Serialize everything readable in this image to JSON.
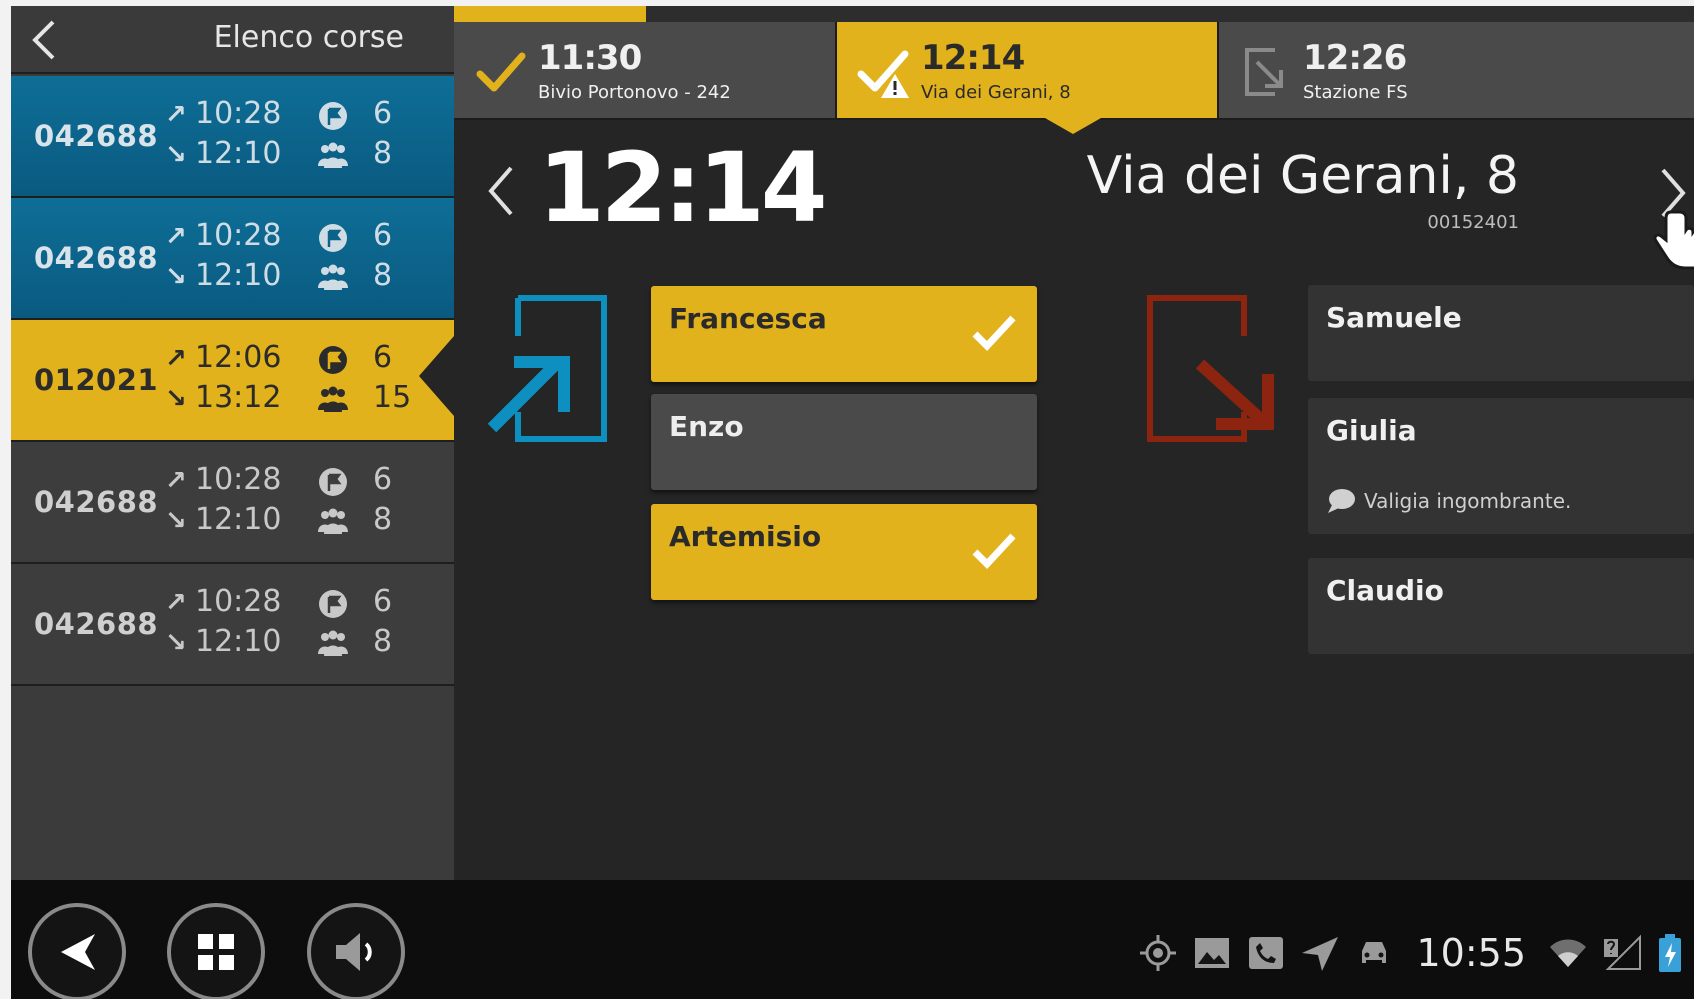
{
  "header": {
    "title": "Elenco corse"
  },
  "runs": [
    {
      "code": "042688",
      "dep": "10:28",
      "arr": "12:10",
      "stops": "6",
      "passengers": "8",
      "state": "blue"
    },
    {
      "code": "042688",
      "dep": "10:28",
      "arr": "12:10",
      "stops": "6",
      "passengers": "8",
      "state": "blue"
    },
    {
      "code": "012021",
      "dep": "12:06",
      "arr": "13:12",
      "stops": "6",
      "passengers": "15",
      "state": "selected"
    },
    {
      "code": "042688",
      "dep": "10:28",
      "arr": "12:10",
      "stops": "6",
      "passengers": "8",
      "state": "grey"
    },
    {
      "code": "042688",
      "dep": "10:28",
      "arr": "12:10",
      "stops": "6",
      "passengers": "8",
      "state": "grey"
    }
  ],
  "progress": {
    "fraction": 0.155
  },
  "tabs": [
    {
      "time": "11:30",
      "name": "Bivio Portonovo - 242",
      "state": "done"
    },
    {
      "time": "12:14",
      "name": "Via dei Gerani, 8",
      "state": "current"
    },
    {
      "time": "12:26",
      "name": "Stazione FS",
      "state": "next"
    }
  ],
  "stop": {
    "time": "12:14",
    "name": "Via dei Gerani, 8",
    "code": "00152401"
  },
  "boarding": [
    {
      "name": "Francesca",
      "checked": true
    },
    {
      "name": "Enzo",
      "checked": false
    },
    {
      "name": "Artemisio",
      "checked": true
    }
  ],
  "alighting": [
    {
      "name": "Samuele",
      "note": ""
    },
    {
      "name": "Giulia",
      "note": "Valigia ingombrante."
    },
    {
      "name": "Claudio",
      "note": ""
    }
  ],
  "status": {
    "clock": "10:55"
  },
  "colors": {
    "accent": "#e2b21c",
    "board": "#0d8fc0",
    "alight": "#8c2410",
    "background": "#252525"
  },
  "icons": {
    "stops": "flag-stops-icon",
    "passengers": "passengers-icon",
    "board": "board-icon",
    "alight": "alight-icon",
    "check": "check-icon",
    "note": "comment-icon"
  }
}
